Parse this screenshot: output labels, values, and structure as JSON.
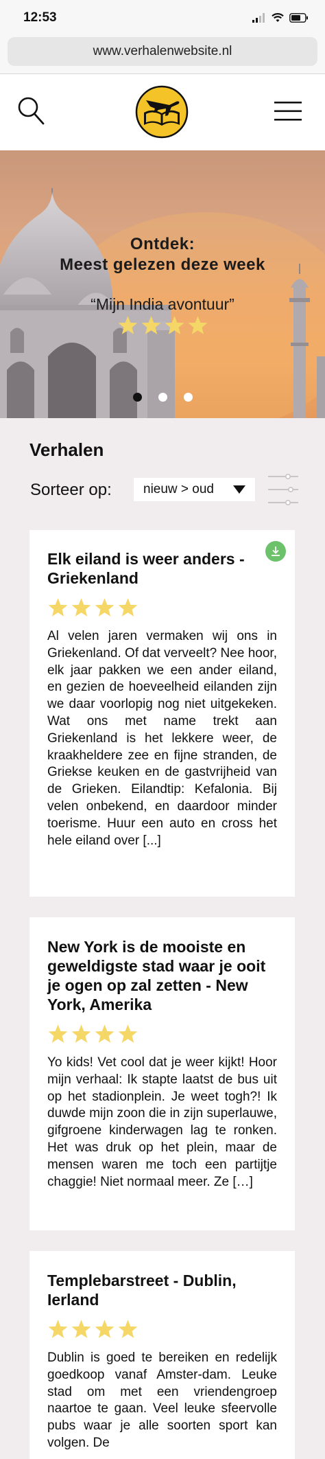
{
  "status_bar": {
    "time": "12:53"
  },
  "browser": {
    "url": "www.verhalenwebsite.nl"
  },
  "header": {
    "logo": "book-airplane-logo"
  },
  "hero": {
    "kicker": "Ontdek:",
    "title": "Meest gelezen deze week",
    "quote": "“Mijn India avontuur”",
    "rating": 4,
    "slides": 3,
    "active_slide": 1
  },
  "section": {
    "title": "Verhalen",
    "sort_label": "Sorteer op:",
    "sort_value": "nieuw > oud"
  },
  "stories": [
    {
      "title": "Elk eiland is weer anders - Griekenland",
      "rating": 4,
      "excerpt": "Al velen jaren vermaken wij ons in Griekenland. Of dat verveelt? Nee hoor, elk jaar pakken we een ander eiland, en gezien de hoeveelheid eilanden zijn we daar voorlopig nog niet uitgekeken. Wat ons met name trekt aan Griekenland is het lekkere weer, de kraakheldere zee en fijne stranden, de Griekse keuken en de gastvrijheid van de Grieken. Eilandtip: Kefalonia. Bij velen onbekend, en daardoor minder toerisme. Huur een auto en cross het hele eiland over [...]"
    },
    {
      "title": "New York is de mooiste en geweldigste stad waar je ooit je ogen op zal zetten - New York, Amerika",
      "rating": 4,
      "excerpt": "Yo kids! Vet cool dat je weer kijkt! Hoor mijn verhaal: Ik stapte laatst de bus uit op het stadionplein. Je weet togh?! Ik duwde mijn zoon die in zijn superlauwe, gifgroene kinderwagen lag te ronken. Het was druk op het plein, maar de mensen waren me toch een partijtje chaggie! Niet normaal meer. Ze […]"
    },
    {
      "title": "Templebarstreet - Dublin, Ierland",
      "rating": 4,
      "excerpt": "Dublin is goed te bereiken en redelijk goedkoop vanaf Amster-dam. Leuke stad om met een vriendengroep naartoe te gaan. Veel leuke sfeervolle pubs waar je alle soorten sport kan volgen. De"
    }
  ],
  "colors": {
    "star": "#f5d767",
    "download": "#6cc16b",
    "page_background": "#f1edee",
    "logo_ring": "#f3c327"
  }
}
